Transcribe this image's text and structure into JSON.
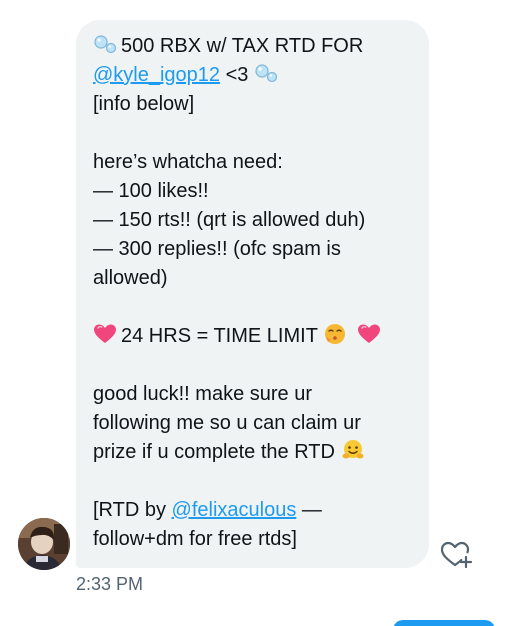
{
  "message": {
    "line1_text": "500 RBX w/ TAX RTD FOR",
    "line2_mention": "@kyle_igop12",
    "line2_suffix": "<3",
    "line3": "[info below]",
    "need_heading": "here’s whatcha need:",
    "req1": "— 100 likes!!",
    "req2": "— 150 rts!! (qrt is allowed duh)",
    "req3a": "— 300 replies!! (ofc spam is",
    "req3b": "allowed)",
    "time_limit": "24 HRS = TIME LIMIT",
    "luck1": "good luck!! make sure ur",
    "luck2": "following me so u can claim ur",
    "luck3": "prize if u complete the RTD",
    "credit_prefix": "[RTD by",
    "credit_mention": "@felixaculous",
    "credit_suffix": "—",
    "credit_line2": "follow+dm for free rtds]"
  },
  "icons": {
    "bubbles": "bubbles-emoji-icon",
    "heart": "pink-heart-emoji-icon",
    "blowing_kiss": "blowing-kiss-emoji-icon",
    "hugging": "hugging-face-emoji-icon",
    "like": "heart-plus-icon"
  },
  "meta": {
    "timestamp": "2:33 PM"
  },
  "colors": {
    "bubble_bg": "#eff3f4",
    "link": "#1d9bf0",
    "text": "#0f1419",
    "muted": "#536471"
  }
}
